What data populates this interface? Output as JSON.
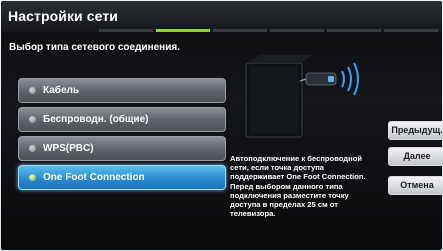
{
  "header": {
    "title": "Настройки сети"
  },
  "subtitle": "Выбор типа сетевого соединения.",
  "options": [
    {
      "label": "Кабель",
      "selected": false
    },
    {
      "label": "Беспроводн. (общие)",
      "selected": false
    },
    {
      "label": "WPS(PBC)",
      "selected": false
    },
    {
      "label": "One Foot Connection",
      "selected": true
    }
  ],
  "description": "Автоподключение к беспроводной сети, если точка доступа поддерживает One Foot Connection. Перед выбором данного типа подключения разместите точку доступа в пределах 25 см от телевизора.",
  "side_buttons": {
    "previous": "Предыдущ.",
    "next": "Далее",
    "cancel": "Отмена"
  },
  "colors": {
    "accent_green": "#8dd13a",
    "selected_blue": "#2a8ad0"
  }
}
